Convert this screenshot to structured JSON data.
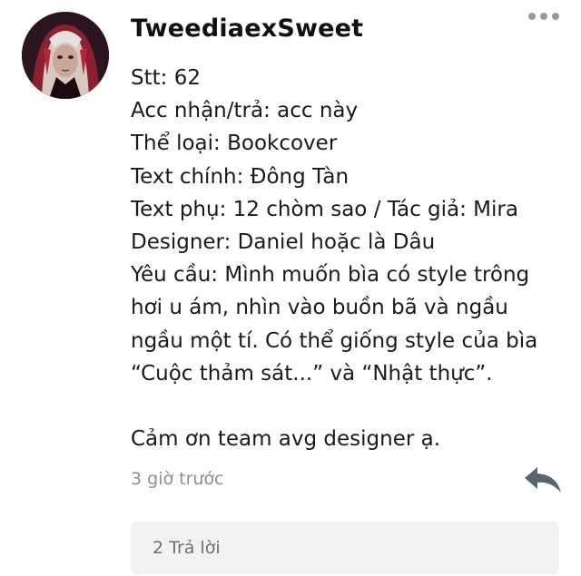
{
  "post": {
    "username": "TweediaexSweet",
    "lines": [
      "Stt: 62",
      "Acc nhận/trả: acc này",
      "Thể loại: Bookcover",
      "Text chính: Đông Tàn",
      "Text phụ: 12 chòm sao / Tác giả: Mira",
      "Designer: Daniel hoặc là Dâu",
      "Yêu cầu: Mình muốn bìa có style trông",
      "hơi u ám, nhìn vào buồn bã và ngầu",
      "ngầu một tí. Có thể giống style của bìa",
      "“Cuộc thảm sát...” và “Nhật thực”.",
      "",
      "Cảm ơn team avg designer ạ."
    ],
    "timestamp": "3 giờ trước",
    "replies_label": "2 Trả lời"
  },
  "icons": {
    "more": "more-dots-icon",
    "reply": "reply-arrow-icon"
  },
  "colors": {
    "text": "#1a1a1a",
    "muted": "#8e8e8e",
    "replies_bg": "#f2f2f2",
    "icon": "#5a6470"
  }
}
